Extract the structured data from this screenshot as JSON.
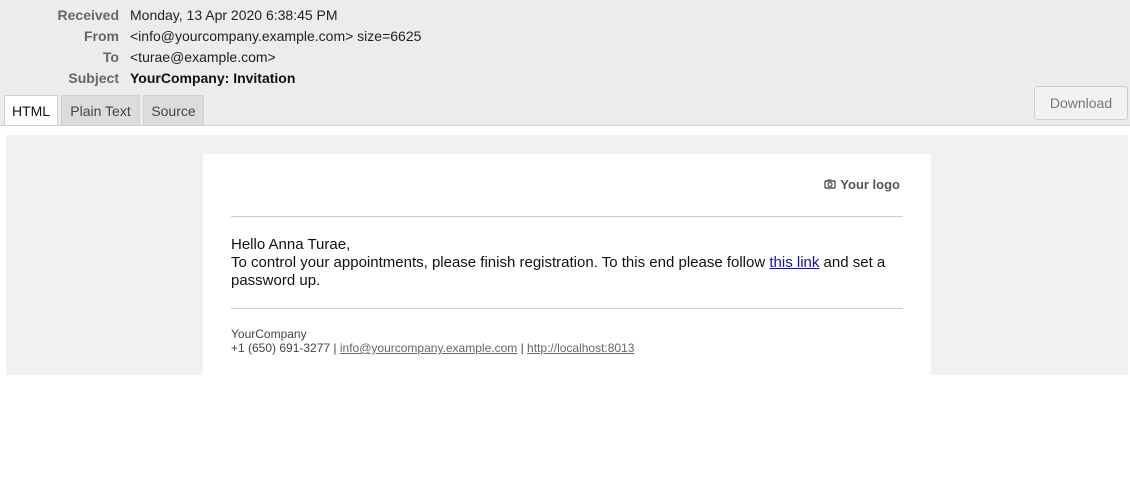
{
  "header": {
    "received_label": "Received",
    "received_value": "Monday, 13 Apr 2020 6:38:45 PM",
    "from_label": "From",
    "from_value": "<info@yourcompany.example.com> size=6625",
    "to_label": "To",
    "to_value": "<turae@example.com>",
    "subject_label": "Subject",
    "subject_value": "YourCompany: Invitation"
  },
  "tabs": [
    {
      "label": "HTML",
      "active": true
    },
    {
      "label": "Plain Text",
      "active": false
    },
    {
      "label": "Source",
      "active": false
    }
  ],
  "download_label": "Download",
  "email": {
    "logo_text": "Your logo",
    "logo_icon": "camera-icon",
    "greeting": "Hello Anna Turae,",
    "body_before_link": "To control your appointments, please finish registration. To this end please follow ",
    "link_text": "this link",
    "body_after_link": " and set a password up.",
    "footer_company": "YourCompany",
    "footer_phone": "+1 (650) 691-3277",
    "footer_sep": " | ",
    "footer_email": "info@yourcompany.example.com",
    "footer_url": "http://localhost:8013"
  },
  "colors": {
    "header_bg": "#ececec",
    "preview_bg": "#f1f1f1",
    "link": "#1a0dab"
  }
}
